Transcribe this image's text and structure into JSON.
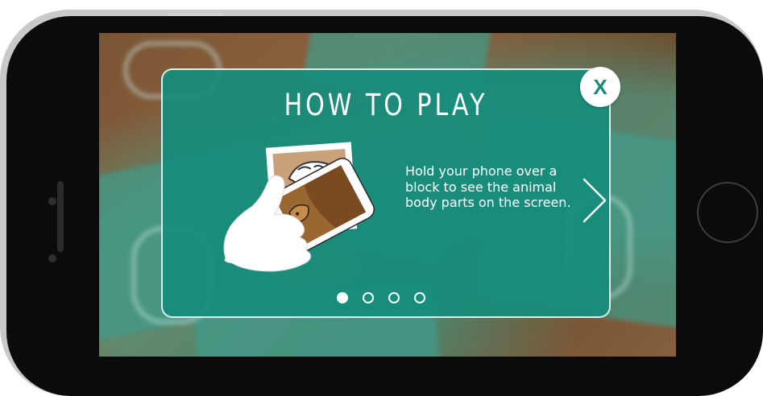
{
  "dialog": {
    "title": "HOW TO PLAY",
    "close_label": "X",
    "instruction": "Hold your phone over a block to see the animal body parts on the screen.",
    "next_icon": "chevron-right-icon",
    "illustration_icon": "hand-holding-phone-over-card-icon"
  },
  "pagination": {
    "pages": 4,
    "current": 1
  },
  "colors": {
    "dialog_teal": "#168c7c",
    "white": "#ffffff",
    "phone_frame": "#0b0b0b"
  }
}
